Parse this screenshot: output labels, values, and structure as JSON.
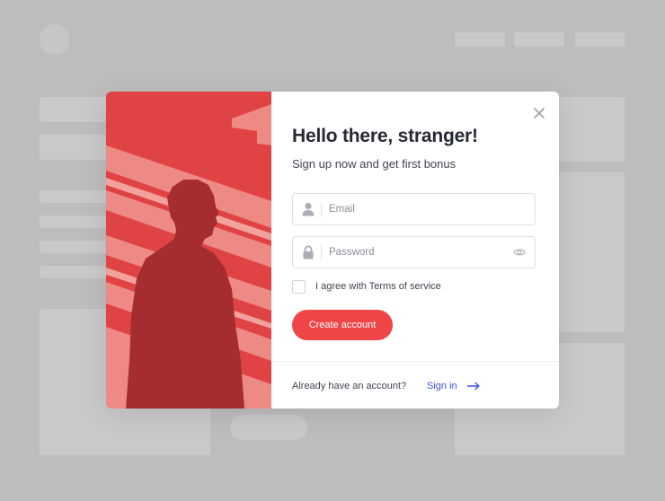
{
  "modal": {
    "title": "Hello there, stranger!",
    "subtitle": "Sign up now and get first bonus",
    "email": {
      "placeholder": "Email",
      "value": "",
      "icon": "user-icon"
    },
    "password": {
      "placeholder": "Password",
      "value": "",
      "icon": "lock-icon",
      "toggle_icon": "eye-icon"
    },
    "terms_label": "I agree with Terms of service",
    "terms_checked": false,
    "create_button": "Create account",
    "footer_text": "Already have an account?",
    "signin_link": "Sign in",
    "close_icon": "close-icon",
    "arrow_icon": "arrow-right-icon"
  },
  "colors": {
    "accent": "#f04546",
    "link": "#3c52e0",
    "illustration_red": "#e04343",
    "overlay": "#bdbdbd"
  }
}
